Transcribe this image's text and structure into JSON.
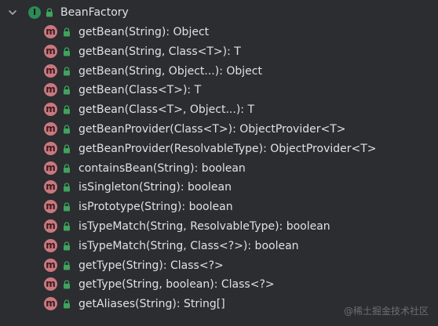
{
  "tree": {
    "root": {
      "label": "BeanFactory",
      "icon": "interface-icon",
      "icon_letter": "I",
      "expanded": true
    },
    "method_icon_letter": "m",
    "methods": [
      "getBean(String): Object",
      "getBean(String, Class<T>): T",
      "getBean(String, Object...): Object",
      "getBean(Class<T>): T",
      "getBean(Class<T>, Object...): T",
      "getBeanProvider(Class<T>): ObjectProvider<T>",
      "getBeanProvider(ResolvableType): ObjectProvider<T>",
      "containsBean(String): boolean",
      "isSingleton(String): boolean",
      "isPrototype(String): boolean",
      "isTypeMatch(String, ResolvableType): boolean",
      "isTypeMatch(String, Class<?>): boolean",
      "getType(String): Class<?>",
      "getType(String, boolean): Class<?>",
      "getAliases(String): String[]"
    ]
  },
  "watermark": {
    "text": "@稀土掘金技术社区"
  },
  "colors": {
    "background": "#2b2d30",
    "text": "#dfe1e5",
    "interface_icon": "#2e8a55",
    "method_icon": "#c9787e",
    "lock": "#3fa35f"
  }
}
